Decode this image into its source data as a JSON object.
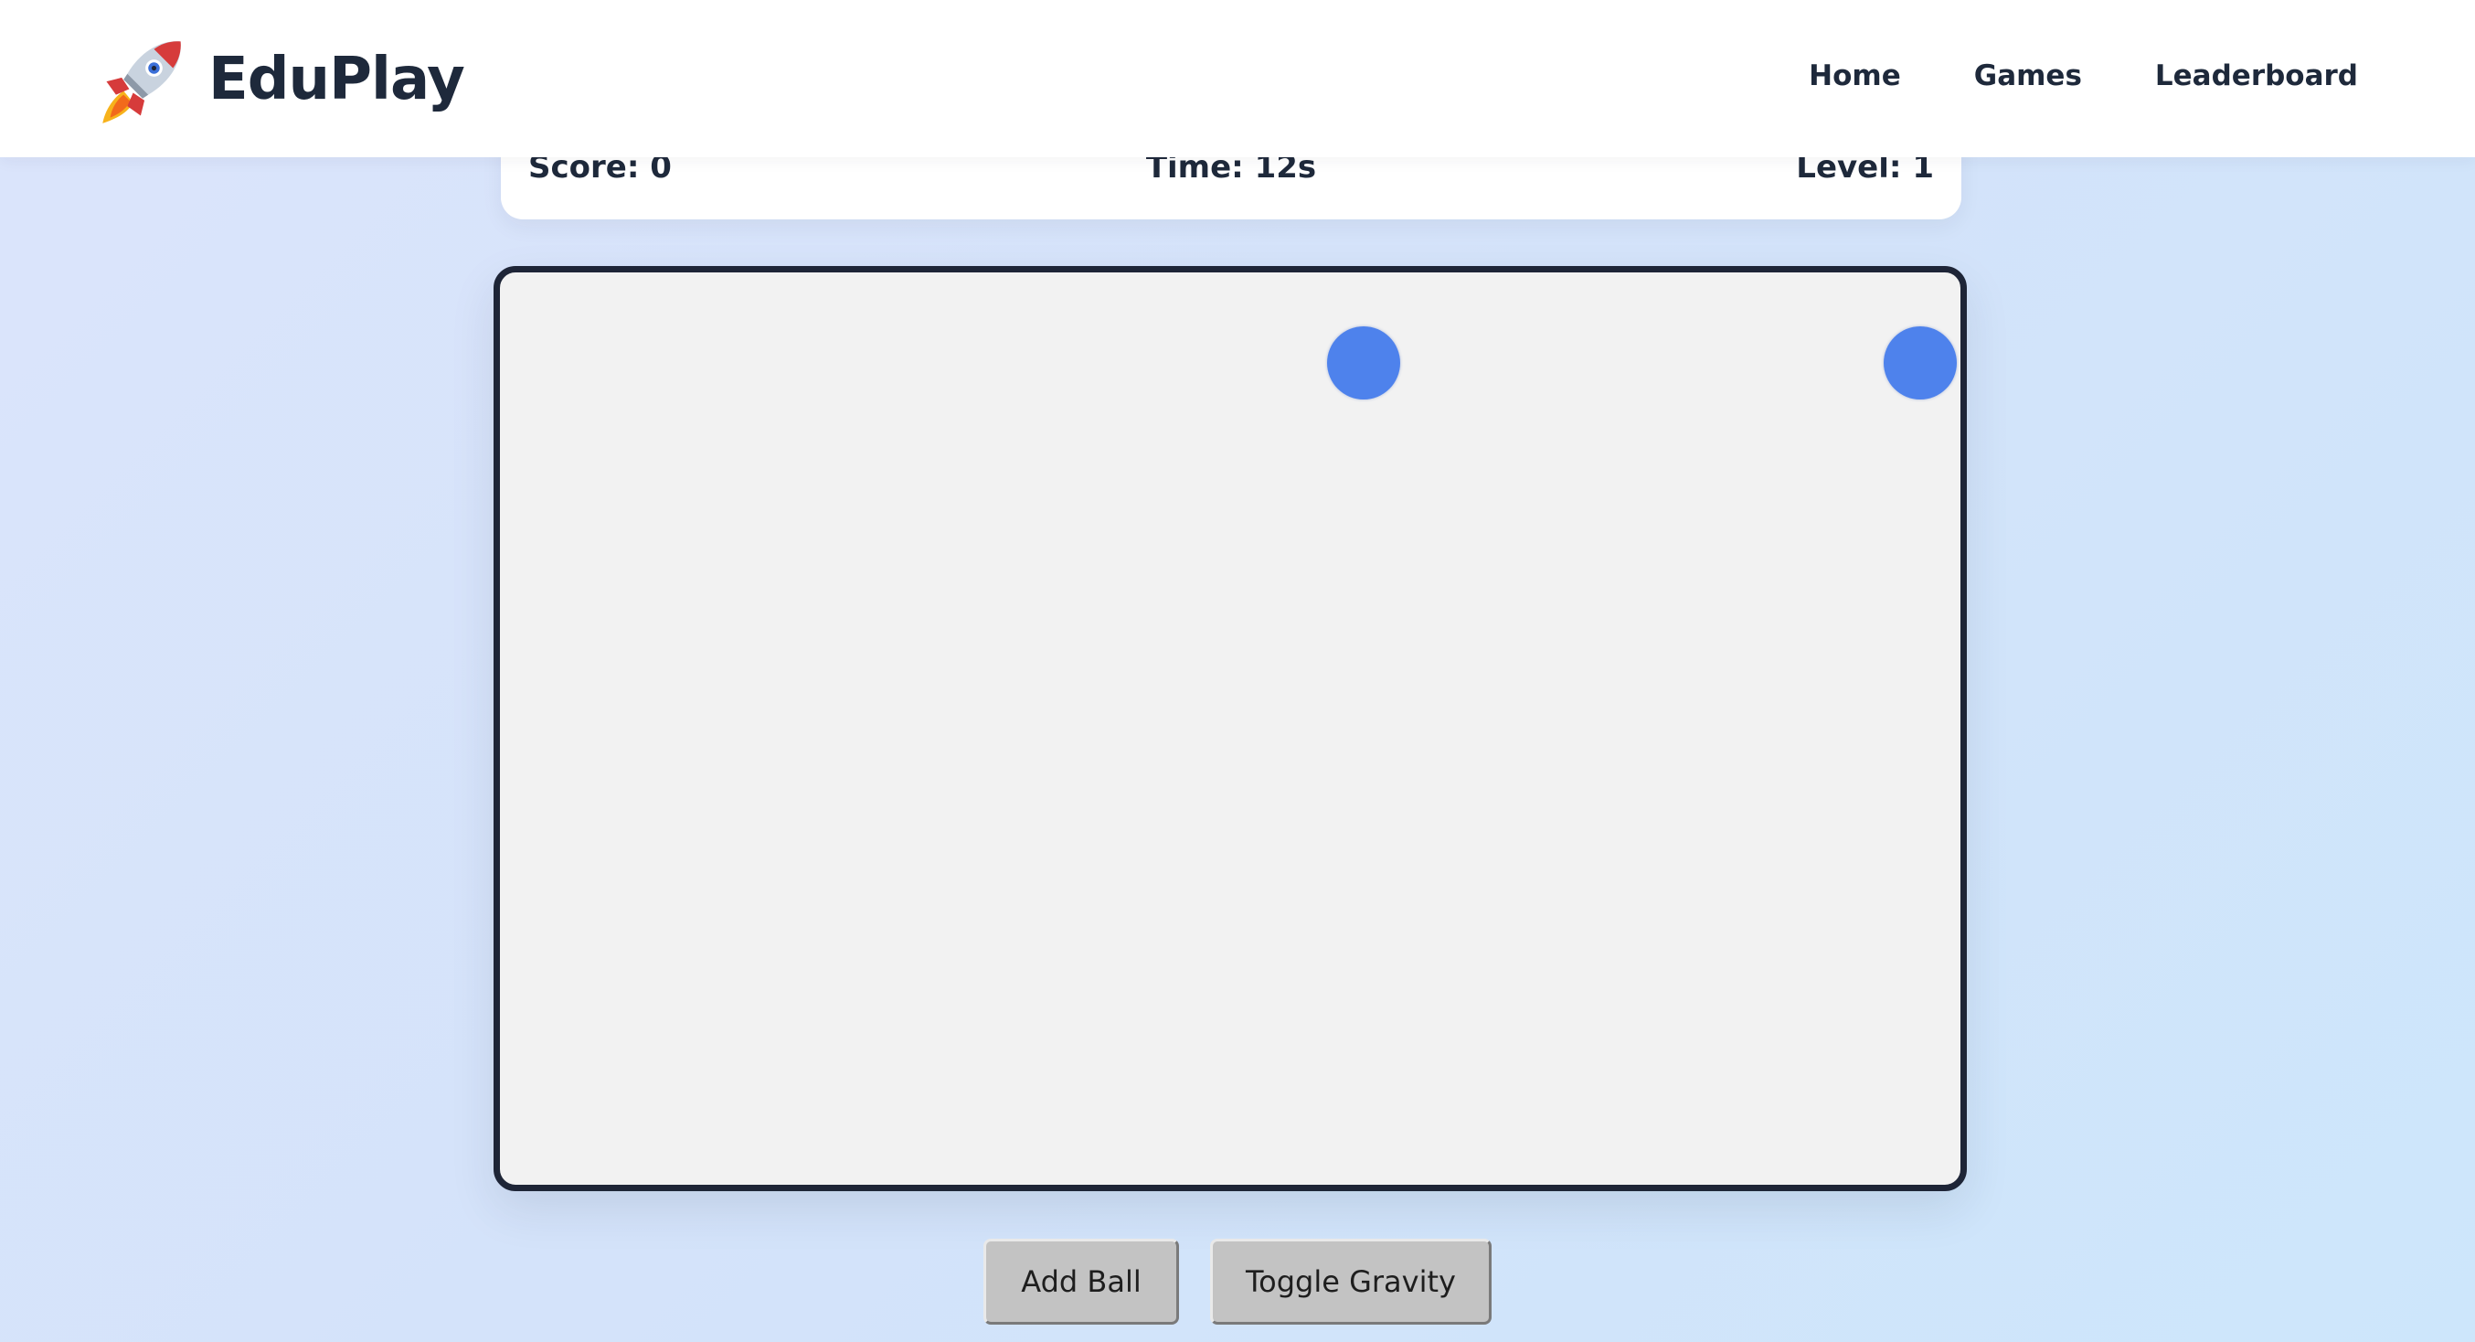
{
  "app": {
    "brand_name": "EduPlay",
    "brand_icon": "rocket-icon"
  },
  "nav": {
    "items": [
      {
        "label": "Home"
      },
      {
        "label": "Games"
      },
      {
        "label": "Leaderboard"
      }
    ]
  },
  "stats": {
    "score": "Score: 0",
    "time": "Time: 12s",
    "level": "Level: 1"
  },
  "game": {
    "ball_color": "#4e82ec",
    "board_background": "#f2f2f2",
    "board_border_color": "#1e2537",
    "ball_count": 2
  },
  "controls": {
    "add_ball_label": "Add Ball",
    "toggle_gravity_label": "Toggle Gravity"
  },
  "colors": {
    "text_dark": "#1e293b",
    "button_gray": "#c3c3c3"
  }
}
